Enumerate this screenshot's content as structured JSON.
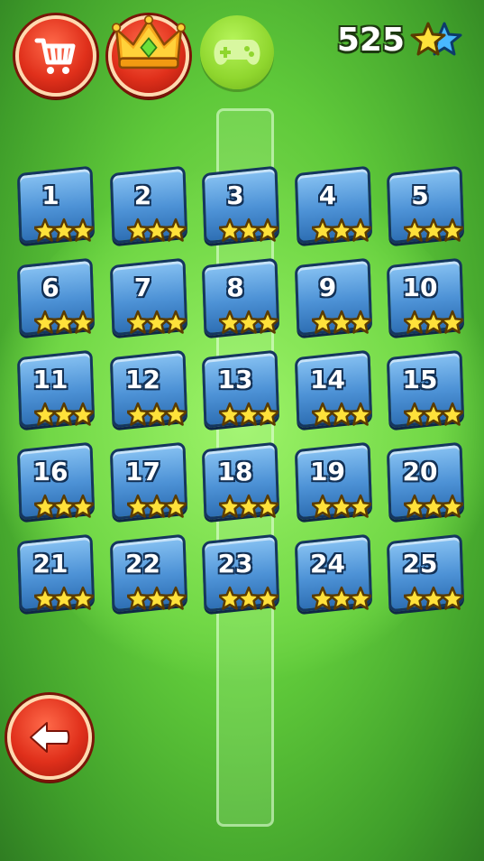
{
  "header": {
    "shop_icon": "shopping-cart-icon",
    "crown_icon": "crown-icon",
    "gamepad_icon": "gamepad-icon",
    "star_count": "525",
    "star_icon": "stars-icon"
  },
  "levels": [
    {
      "number": "1",
      "stars": 3
    },
    {
      "number": "2",
      "stars": 3
    },
    {
      "number": "3",
      "stars": 3
    },
    {
      "number": "4",
      "stars": 3
    },
    {
      "number": "5",
      "stars": 3
    },
    {
      "number": "6",
      "stars": 3
    },
    {
      "number": "7",
      "stars": 3
    },
    {
      "number": "8",
      "stars": 3
    },
    {
      "number": "9",
      "stars": 3
    },
    {
      "number": "10",
      "stars": 3
    },
    {
      "number": "11",
      "stars": 3
    },
    {
      "number": "12",
      "stars": 3
    },
    {
      "number": "13",
      "stars": 3
    },
    {
      "number": "14",
      "stars": 3
    },
    {
      "number": "15",
      "stars": 3
    },
    {
      "number": "16",
      "stars": 3
    },
    {
      "number": "17",
      "stars": 3
    },
    {
      "number": "18",
      "stars": 3
    },
    {
      "number": "19",
      "stars": 3
    },
    {
      "number": "20",
      "stars": 3
    },
    {
      "number": "21",
      "stars": 3
    },
    {
      "number": "22",
      "stars": 3
    },
    {
      "number": "23",
      "stars": 3
    },
    {
      "number": "24",
      "stars": 3
    },
    {
      "number": "25",
      "stars": 3
    }
  ],
  "footer": {
    "back_icon": "back-arrow-icon"
  },
  "colors": {
    "background": "#5fc93a",
    "tile_blue": "#4d92d6",
    "button_red": "#e0301b",
    "star_yellow": "#ffe13a"
  }
}
